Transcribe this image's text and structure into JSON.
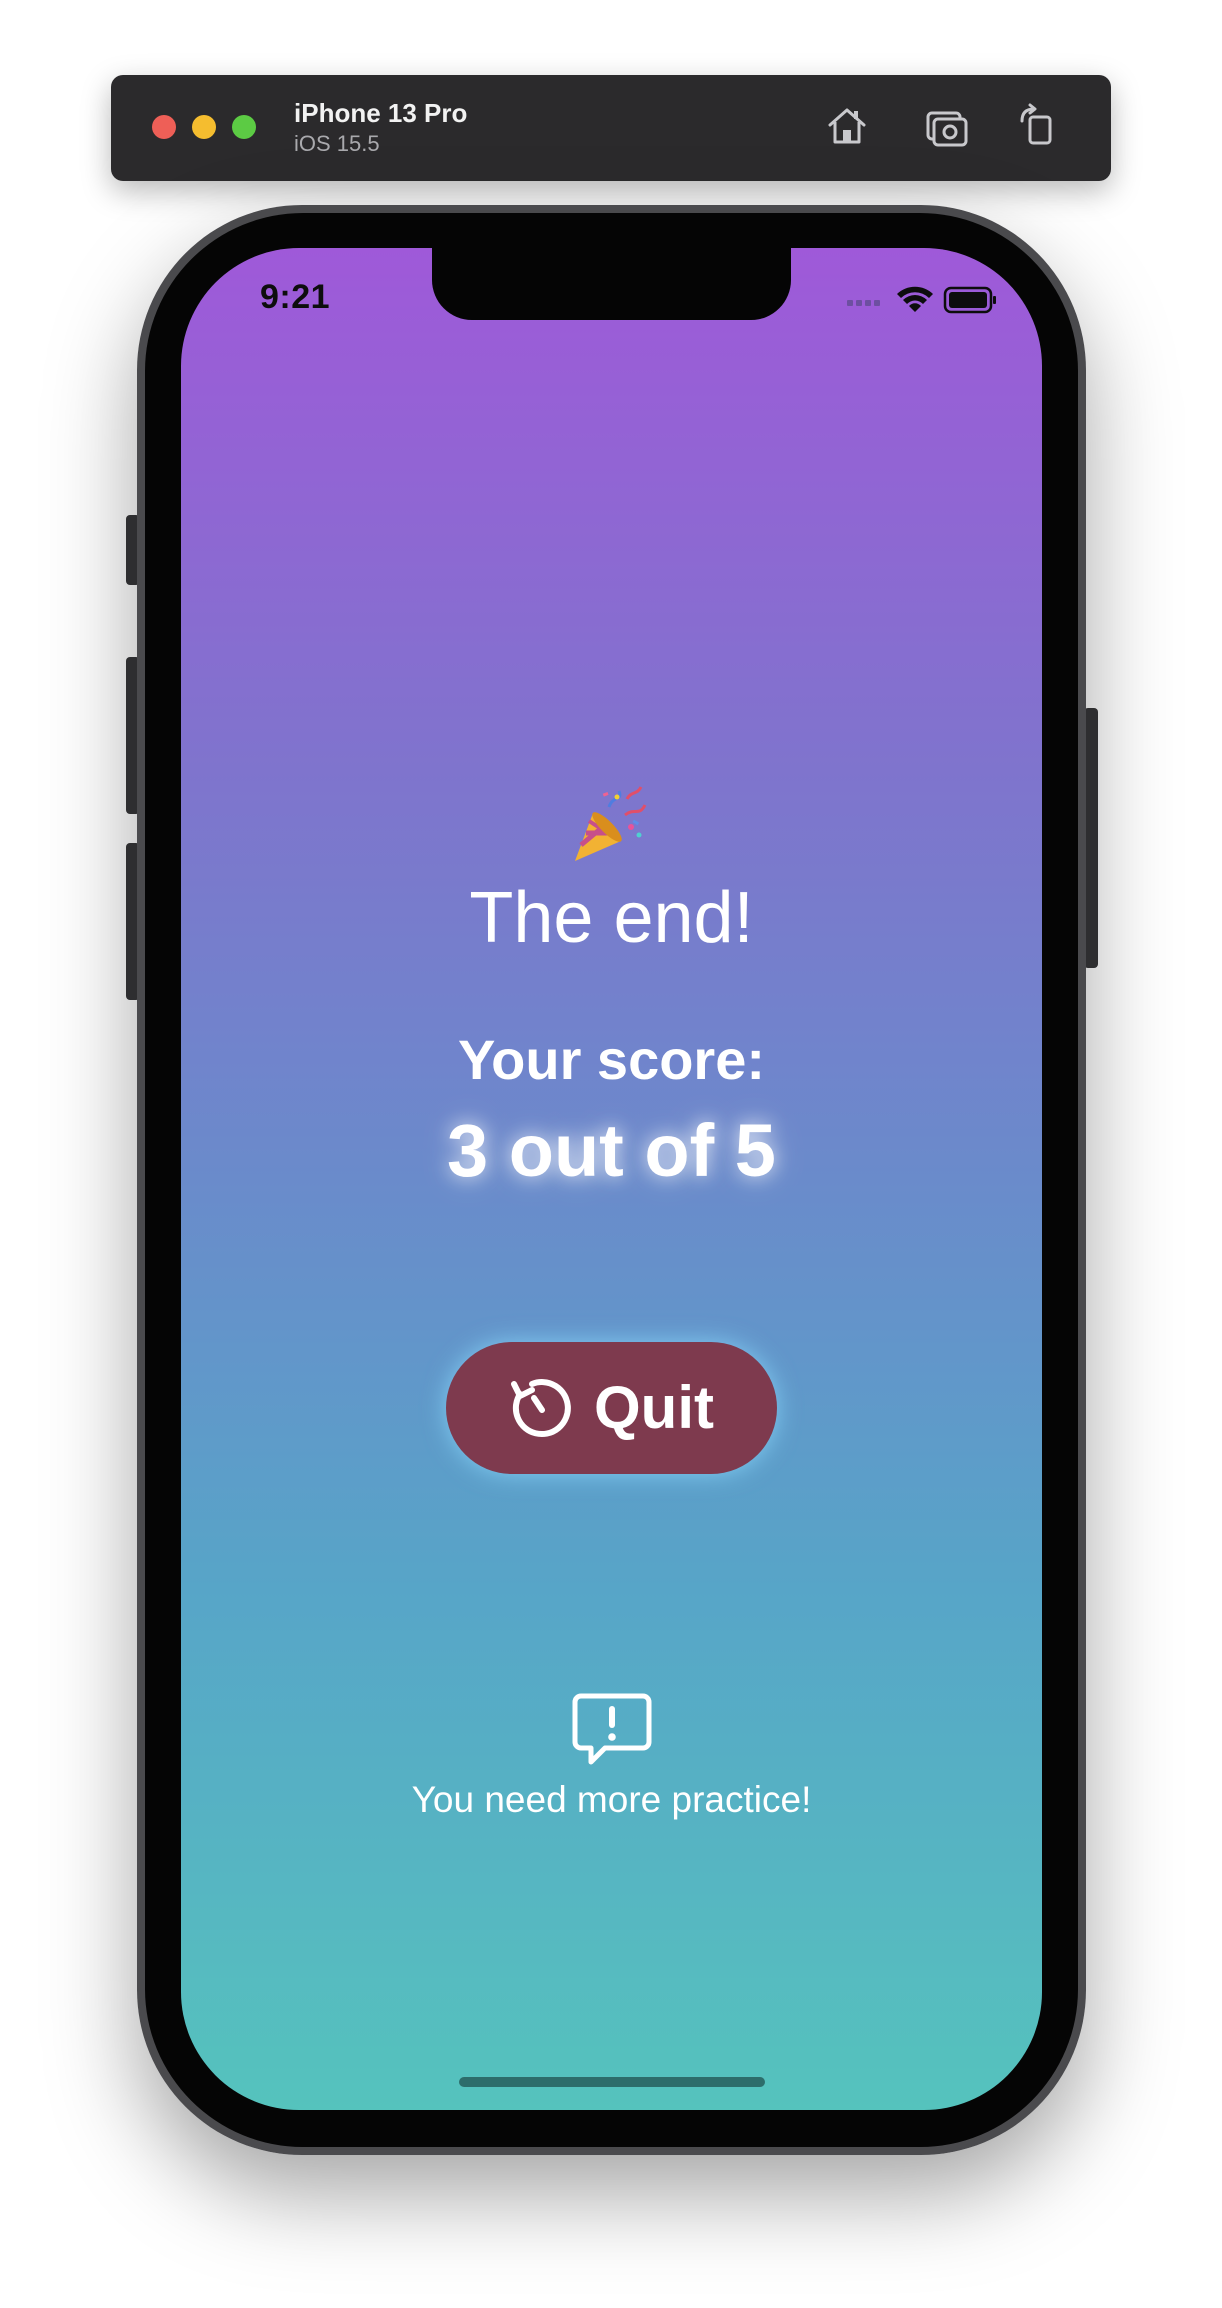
{
  "simulator": {
    "device_name": "iPhone 13 Pro",
    "os_version": "iOS 15.5",
    "toolbar_icons": [
      "home-icon",
      "screenshot-icon",
      "rotate-icon"
    ]
  },
  "status_bar": {
    "time": "9:21",
    "icons": [
      "signal-icon",
      "wifi-icon",
      "battery-icon"
    ]
  },
  "screen": {
    "gradient_top": "#9f59d9",
    "gradient_bottom": "#55c3bd",
    "emoji": "party-popper-icon",
    "title": "The end!",
    "score_label": "Your score:",
    "score_value": "3 out of 5",
    "score": {
      "correct": 3,
      "total": 5
    },
    "quit_button": {
      "label": "Quit",
      "icon": "restart-icon",
      "color": "#7e3a4e"
    },
    "feedback": {
      "icon": "exclamation-bubble-icon",
      "text": "You need more practice!"
    }
  }
}
